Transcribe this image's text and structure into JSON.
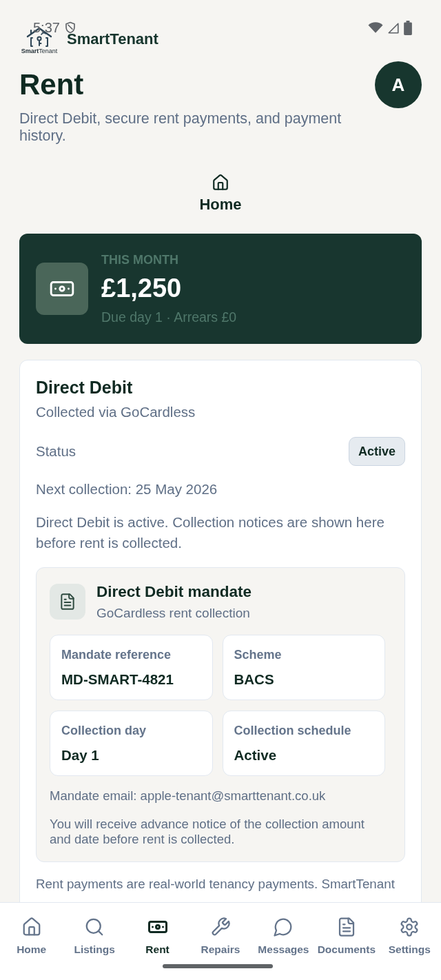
{
  "status_bar": {
    "time": "5:37"
  },
  "header": {
    "logo_text": "**Smart**Tenant",
    "app_name": "SmartTenant"
  },
  "page": {
    "title": "Rent",
    "avatar": "A",
    "subtitle": "Direct Debit, secure rent payments, and payment history."
  },
  "tabs": [
    {
      "label": "Home",
      "selected": true
    }
  ],
  "summary_card": {
    "eyebrow": "THIS MONTH",
    "amount": "£1,250",
    "detail": "Due day 1 · Arrears £0"
  },
  "direct_debit": {
    "title": "Direct Debit",
    "subtitle": "Collected via GoCardless",
    "status_label": "Status",
    "status": "Active",
    "next_collection": "Next collection: 25 May 2026",
    "description": "Direct Debit is active. Collection notices are shown here before rent is collected.",
    "mandate": {
      "title": "Direct Debit mandate",
      "subtitle": "GoCardless rent collection",
      "fields": [
        {
          "label": "Mandate reference",
          "value": "MD-SMART-4821"
        },
        {
          "label": "Scheme",
          "value": "BACS"
        },
        {
          "label": "Collection day",
          "value": "Day 1"
        },
        {
          "label": "Collection schedule",
          "value": "Active"
        }
      ],
      "email": "Mandate email: apple-tenant@smarttenant.co.uk",
      "notice": "You will receive advance notice of the collection amount and date before rent is collected."
    },
    "footnote": "Rent payments are real-world tenancy payments. SmartTenant"
  },
  "bottom_nav": [
    {
      "label": "Home",
      "selected": false
    },
    {
      "label": "Listings",
      "selected": false
    },
    {
      "label": "Rent",
      "selected": true
    },
    {
      "label": "Repairs",
      "selected": false
    },
    {
      "label": "Messages",
      "selected": false
    },
    {
      "label": "Documents",
      "selected": false
    },
    {
      "label": "Settings",
      "selected": false
    }
  ]
}
